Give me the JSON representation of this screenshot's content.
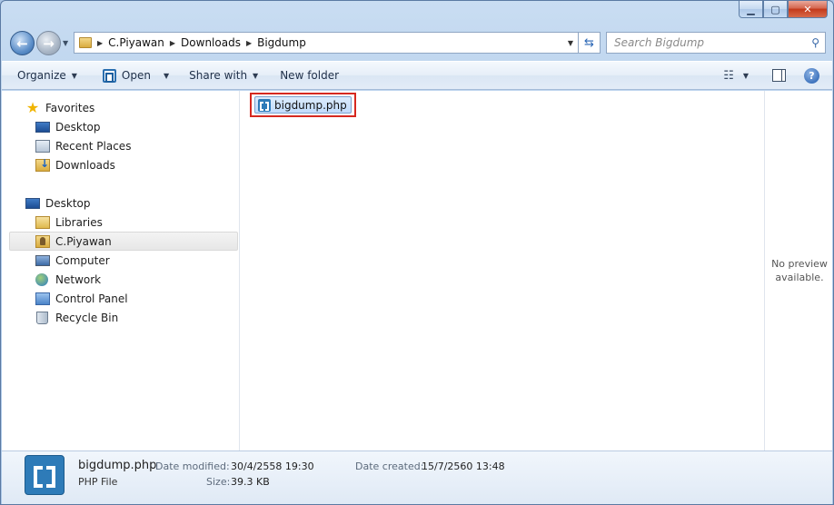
{
  "address": {
    "crumbs": [
      "C.Piyawan",
      "Downloads",
      "Bigdump"
    ]
  },
  "search": {
    "placeholder": "Search Bigdump"
  },
  "toolbar": {
    "organize": "Organize",
    "open": "Open",
    "share_with": "Share with",
    "new_folder": "New folder"
  },
  "nav": {
    "favorites": "Favorites",
    "desktop_fav": "Desktop",
    "recent_places": "Recent Places",
    "downloads": "Downloads",
    "desktop": "Desktop",
    "libraries": "Libraries",
    "user": "C.Piyawan",
    "computer": "Computer",
    "network": "Network",
    "control_panel": "Control Panel",
    "recycle_bin": "Recycle Bin"
  },
  "files": [
    {
      "name": "bigdump.php"
    }
  ],
  "preview": {
    "line1": "No preview",
    "line2": "available."
  },
  "details": {
    "name": "bigdump.php",
    "type": "PHP File",
    "date_modified_label": "Date modified:",
    "date_modified": "30/4/2558 19:30",
    "size_label": "Size:",
    "size": "39.3 KB",
    "date_created_label": "Date created:",
    "date_created": "15/7/2560 13:48"
  }
}
